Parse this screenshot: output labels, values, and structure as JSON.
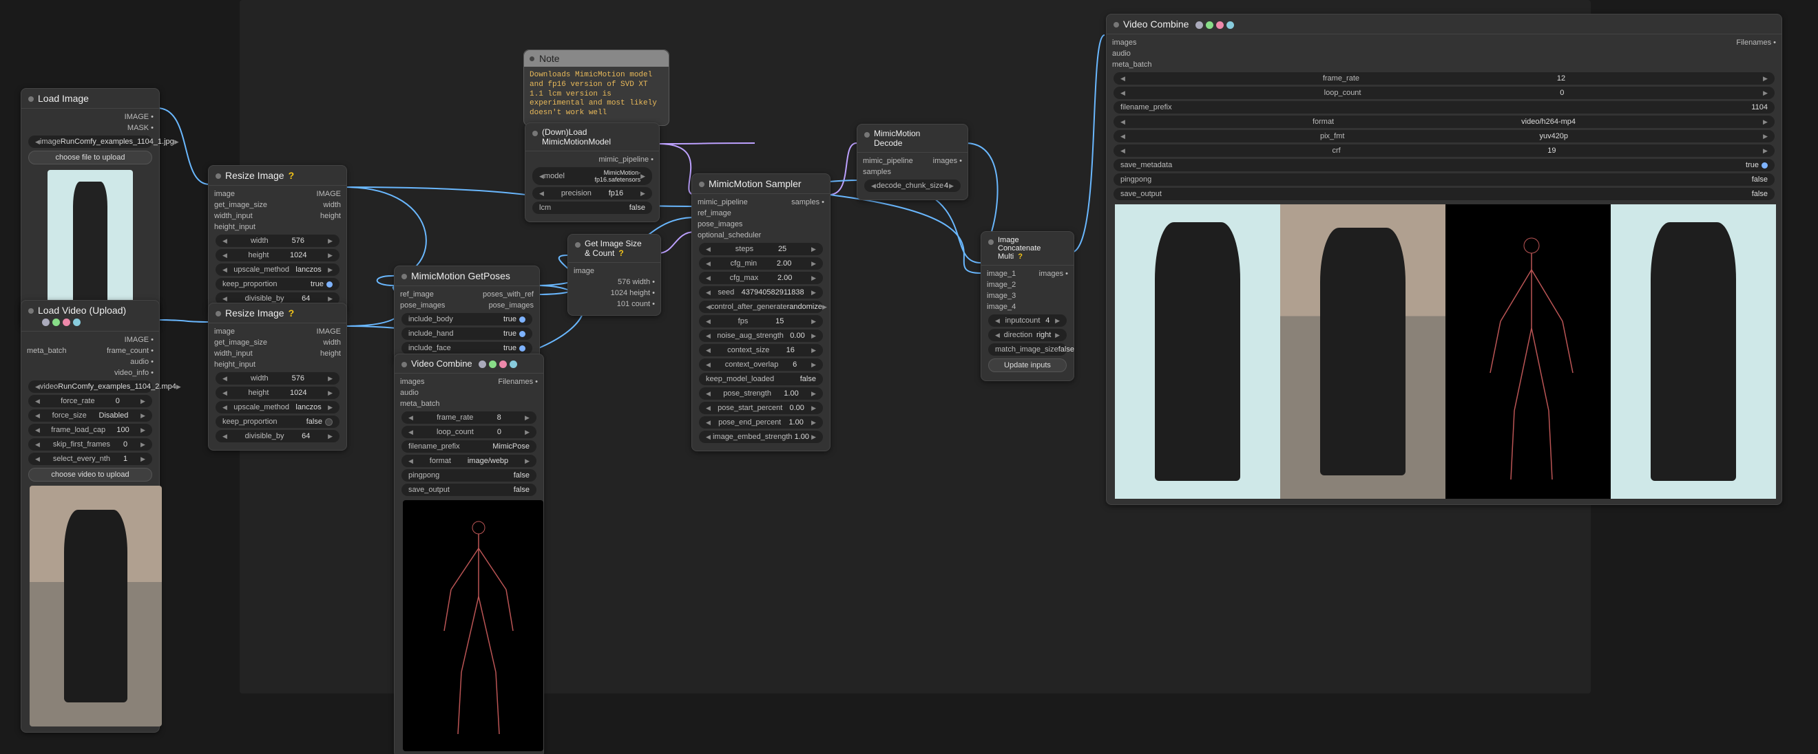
{
  "note": {
    "title": "Note",
    "text": "Downloads MimicMotion model and fp16 version of SVD XT 1.1  lcm version is experimental and most likely doesn't work well"
  },
  "load_image": {
    "title": "Load Image",
    "out1": "IMAGE •",
    "out2": "MASK •",
    "widget_label": "image",
    "image": "RunComfy_examples_1104_1.jpg",
    "choose": "choose file to upload"
  },
  "load_video": {
    "title": "Load Video (Upload)",
    "inputs": [
      "meta_batch"
    ],
    "outputs": [
      "IMAGE •",
      "frame_count •",
      "audio •",
      "video_info •"
    ],
    "widgets": [
      {
        "label": "video",
        "value": "RunComfy_examples_1104_2.mp4"
      },
      {
        "label": "force_rate",
        "value": "0"
      },
      {
        "label": "force_size",
        "value": "Disabled"
      },
      {
        "label": "frame_load_cap",
        "value": "100"
      },
      {
        "label": "skip_first_frames",
        "value": "0"
      },
      {
        "label": "select_every_nth",
        "value": "1"
      }
    ],
    "choose": "choose video to upload"
  },
  "resize1": {
    "title": "Resize Image",
    "ins": [
      "image",
      "get_image_size",
      "width_input",
      "height_input"
    ],
    "outs": [
      "IMAGE",
      "width",
      "height"
    ],
    "w": [
      {
        "l": "width",
        "v": "576"
      },
      {
        "l": "height",
        "v": "1024"
      },
      {
        "l": "upscale_method",
        "v": "lanczos"
      },
      {
        "l": "keep_proportion",
        "v": "true"
      },
      {
        "l": "divisible_by",
        "v": "64"
      }
    ]
  },
  "resize2": {
    "title": "Resize Image",
    "ins": [
      "image",
      "get_image_size",
      "width_input",
      "height_input"
    ],
    "outs": [
      "IMAGE",
      "width",
      "height"
    ],
    "w": [
      {
        "l": "width",
        "v": "576"
      },
      {
        "l": "height",
        "v": "1024"
      },
      {
        "l": "upscale_method",
        "v": "lanczos"
      },
      {
        "l": "keep_proportion",
        "v": "false"
      },
      {
        "l": "divisible_by",
        "v": "64"
      }
    ]
  },
  "getposes": {
    "title": "MimicMotion GetPoses",
    "ins": [
      "ref_image",
      "pose_images"
    ],
    "outs": [
      "poses_with_ref",
      "pose_images"
    ],
    "w": [
      {
        "l": "include_body",
        "v": "true"
      },
      {
        "l": "include_hand",
        "v": "true"
      },
      {
        "l": "include_face",
        "v": "true"
      }
    ]
  },
  "getsize": {
    "title": "Get Image Size & Count",
    "ins": [
      "image"
    ],
    "outs": [
      "576 width •",
      "1024 height •",
      "101 count •"
    ]
  },
  "vc_small": {
    "title": "Video Combine",
    "ins": [
      "images",
      "audio",
      "meta_batch"
    ],
    "outs": [
      "Filenames •"
    ],
    "w": [
      {
        "l": "frame_rate",
        "v": "8"
      },
      {
        "l": "loop_count",
        "v": "0"
      },
      {
        "l": "filename_prefix",
        "v": "MimicPose"
      },
      {
        "l": "format",
        "v": "image/webp"
      },
      {
        "l": "pingpong",
        "v": "false"
      },
      {
        "l": "save_output",
        "v": "false"
      }
    ]
  },
  "load_model": {
    "title": "(Down)Load MimicMotionModel",
    "outs": [
      "mimic_pipeline •"
    ],
    "w": [
      {
        "l": "model",
        "v": "MimicMotion-fp16.safetensors"
      },
      {
        "l": "precision",
        "v": "fp16"
      },
      {
        "l": "lcm",
        "v": "false"
      }
    ]
  },
  "sampler": {
    "title": "MimicMotion Sampler",
    "ins": [
      "mimic_pipeline",
      "ref_image",
      "pose_images",
      "optional_scheduler"
    ],
    "outs": [
      "samples •"
    ],
    "w": [
      {
        "l": "steps",
        "v": "25"
      },
      {
        "l": "cfg_min",
        "v": "2.00"
      },
      {
        "l": "cfg_max",
        "v": "2.00"
      },
      {
        "l": "seed",
        "v": "437940582911838"
      },
      {
        "l": "control_after_generate",
        "v": "randomize"
      },
      {
        "l": "fps",
        "v": "15"
      },
      {
        "l": "noise_aug_strength",
        "v": "0.00"
      },
      {
        "l": "context_size",
        "v": "16"
      },
      {
        "l": "context_overlap",
        "v": "6"
      },
      {
        "l": "keep_model_loaded",
        "v": "false"
      },
      {
        "l": "pose_strength",
        "v": "1.00"
      },
      {
        "l": "pose_start_percent",
        "v": "0.00"
      },
      {
        "l": "pose_end_percent",
        "v": "1.00"
      },
      {
        "l": "image_embed_strength",
        "v": "1.00"
      }
    ]
  },
  "decode": {
    "title": "MimicMotion Decode",
    "ins": [
      "mimic_pipeline",
      "samples"
    ],
    "outs": [
      "images •"
    ],
    "w": [
      {
        "l": "decode_chunk_size",
        "v": "4"
      }
    ]
  },
  "concat": {
    "title": "Image Concatenate Multi",
    "ins": [
      "image_1",
      "image_2",
      "image_3",
      "image_4"
    ],
    "outs": [
      "images •"
    ],
    "w": [
      {
        "l": "inputcount",
        "v": "4"
      },
      {
        "l": "direction",
        "v": "right"
      },
      {
        "l": "match_image_size",
        "v": "false"
      }
    ],
    "btn": "Update inputs"
  },
  "vc_large": {
    "title": "Video Combine",
    "ins": [
      "images",
      "audio",
      "meta_batch"
    ],
    "outs": [
      "Filenames •"
    ],
    "w": [
      {
        "l": "frame_rate",
        "v": "12"
      },
      {
        "l": "loop_count",
        "v": "0"
      },
      {
        "l": "filename_prefix",
        "v": "1104"
      },
      {
        "l": "format",
        "v": "video/h264-mp4"
      },
      {
        "l": "pix_fmt",
        "v": "yuv420p"
      },
      {
        "l": "crf",
        "v": "19"
      },
      {
        "l": "save_metadata",
        "v": "true"
      },
      {
        "l": "pingpong",
        "v": "false"
      },
      {
        "l": "save_output",
        "v": "false"
      }
    ]
  }
}
